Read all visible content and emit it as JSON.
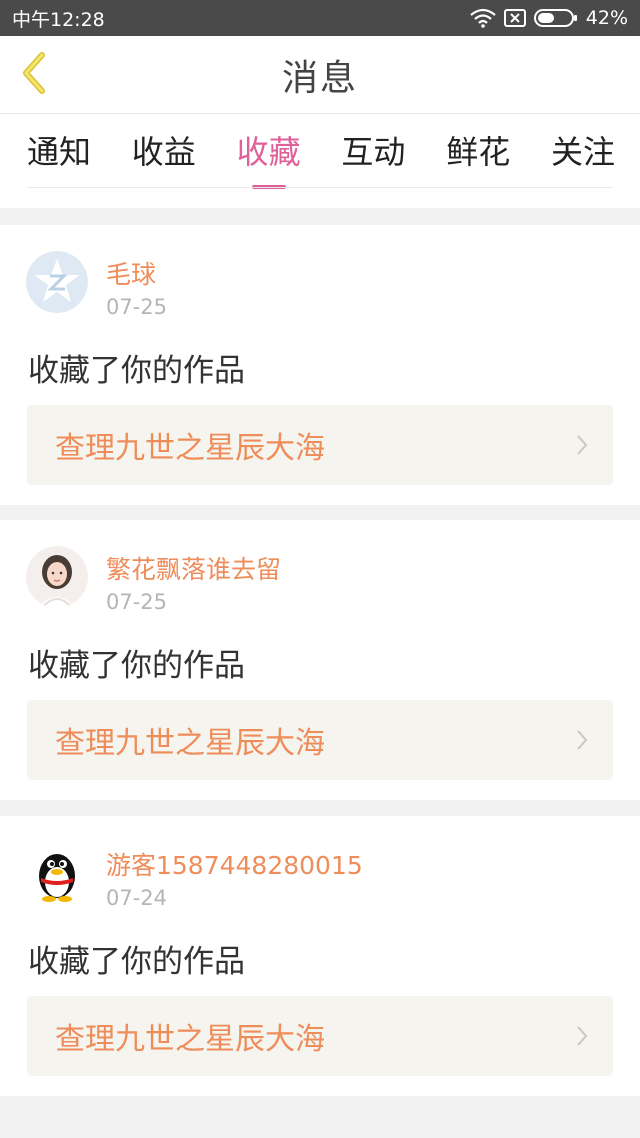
{
  "status_bar": {
    "time": "中午12:28",
    "battery": "42%",
    "icons": [
      "wifi-icon",
      "sim-card-icon",
      "battery-icon"
    ]
  },
  "header": {
    "title": "消息",
    "back_icon": "chevron-left-icon"
  },
  "tabs": [
    {
      "label": "通知",
      "active": false
    },
    {
      "label": "收益",
      "active": false
    },
    {
      "label": "收藏",
      "active": true
    },
    {
      "label": "互动",
      "active": false
    },
    {
      "label": "鲜花",
      "active": false
    },
    {
      "label": "关注",
      "active": false
    }
  ],
  "messages": [
    {
      "username": "毛球",
      "date": "07-25",
      "action": "收藏了你的作品",
      "work_title": "查理九世之星辰大海",
      "avatar": "qzone-star-avatar"
    },
    {
      "username": "繁花飘落谁去留",
      "date": "07-25",
      "action": "收藏了你的作品",
      "work_title": "查理九世之星辰大海",
      "avatar": "girl-photo-avatar"
    },
    {
      "username": "游客1587448280015",
      "date": "07-24",
      "action": "收藏了你的作品",
      "work_title": "查理九世之星辰大海",
      "avatar": "qq-penguin-avatar"
    }
  ],
  "colors": {
    "accent_pink": "#e0609a",
    "accent_orange": "#ef8d5a",
    "status_bar_bg": "#4a4a4a",
    "card_box_bg": "#f5f4ee"
  }
}
